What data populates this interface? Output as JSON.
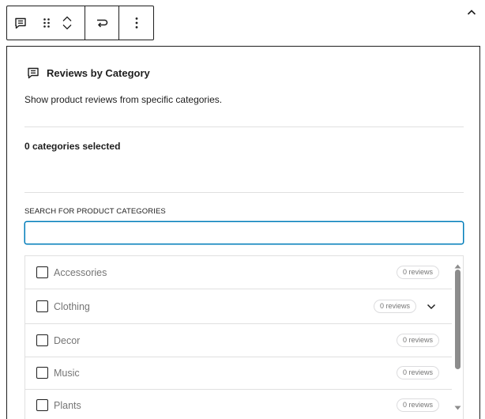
{
  "toolbar": {
    "icons": [
      "comment-icon",
      "drag-handle-icon",
      "move-up-icon",
      "move-down-icon",
      "transform-icon",
      "more-options-icon"
    ]
  },
  "block": {
    "title": "Reviews by Category",
    "description": "Show product reviews from specific categories.",
    "selected_count": "0 categories selected",
    "search": {
      "label": "SEARCH FOR PRODUCT CATEGORIES",
      "value": "",
      "placeholder": ""
    },
    "categories": [
      {
        "label": "Accessories",
        "reviews": "0 reviews",
        "expandable": false
      },
      {
        "label": "Clothing",
        "reviews": "0 reviews",
        "expandable": true
      },
      {
        "label": "Decor",
        "reviews": "0 reviews",
        "expandable": false
      },
      {
        "label": "Music",
        "reviews": "0 reviews",
        "expandable": false
      },
      {
        "label": "Plants",
        "reviews": "0 reviews",
        "expandable": false
      }
    ]
  },
  "colors": {
    "accent": "#007cba",
    "border": "#1e1e1e",
    "divider": "#e0e0e0",
    "muted_text": "#757575"
  }
}
